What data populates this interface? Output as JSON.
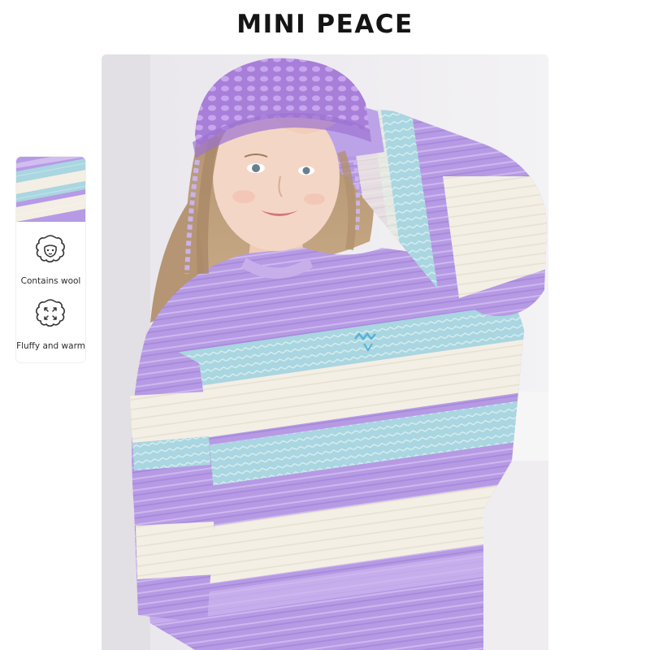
{
  "brand": {
    "name": "MINI PEACE"
  },
  "product_photo": {
    "description_icon": "product-photo"
  },
  "features": [
    {
      "icon": "sheep-icon",
      "label": "Contains wool"
    },
    {
      "icon": "warm-fluffy-icon",
      "label": "Fluffy and warm"
    }
  ],
  "colors": {
    "lavender": "#b79ae6",
    "mint": "#a7d8df",
    "cream": "#f4f0e6",
    "brand_text": "#141414"
  }
}
